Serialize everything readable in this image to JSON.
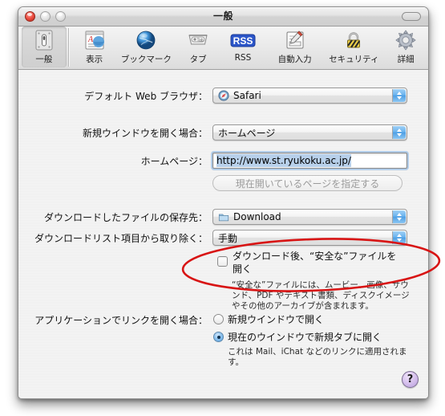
{
  "window": {
    "title": "一般",
    "controls": {
      "close": "close-button",
      "minimize": "minimize-button",
      "zoom": "zoom-button",
      "toolbar_toggle": "toolbar-toggle-button"
    }
  },
  "toolbar": {
    "items": [
      {
        "id": "general",
        "label": "一般",
        "icon": "general-icon",
        "selected": true
      },
      {
        "id": "appearance",
        "label": "表示",
        "icon": "appearance-icon",
        "selected": false
      },
      {
        "id": "bookmarks",
        "label": "ブックマーク",
        "icon": "bookmarks-icon",
        "selected": false
      },
      {
        "id": "tabs",
        "label": "タブ",
        "icon": "tabs-icon",
        "selected": false
      },
      {
        "id": "rss",
        "label": "RSS",
        "icon": "rss-icon",
        "selected": false
      },
      {
        "id": "autofill",
        "label": "自動入力",
        "icon": "autofill-icon",
        "selected": false
      },
      {
        "id": "security",
        "label": "セキュリティ",
        "icon": "security-icon",
        "selected": false
      },
      {
        "id": "advanced",
        "label": "詳細",
        "icon": "advanced-icon",
        "selected": false
      }
    ]
  },
  "form": {
    "default_browser": {
      "label": "デフォルト Web ブラウザ：",
      "value": "Safari",
      "icon": "safari-icon"
    },
    "new_window_opens": {
      "label": "新規ウインドウを開く場合：",
      "value": "ホームページ"
    },
    "homepage": {
      "label": "ホームページ：",
      "value": "http://www.st.ryukoku.ac.jp/",
      "selected": true
    },
    "set_current_page_button": {
      "label": "現在開いているページを指定する",
      "enabled": false
    },
    "download_location": {
      "label": "ダウンロードしたファイルの保存先：",
      "value": "Download",
      "icon": "folder-icon"
    },
    "remove_download_items": {
      "label": "ダウンロードリスト項目から取り除く：",
      "value": "手動"
    },
    "open_safe_files": {
      "label": "ダウンロード後、“安全な”ファイルを開く",
      "checked": false,
      "hint": "“安全な”ファイルには、ムービー、画像、サウンド、PDF やテキスト書類、ディスクイメージやその他のアーカイブが含まれます。"
    },
    "open_links_from_apps": {
      "label": "アプリケーションでリンクを開く場合：",
      "options": [
        {
          "label": "新規ウインドウで開く",
          "selected": false
        },
        {
          "label": "現在のウインドウで新規タブに開く",
          "selected": true
        }
      ],
      "hint": "これは Mail、iChat などのリンクに適用されます。"
    }
  },
  "help_button": {
    "label": "?"
  },
  "annotation": {
    "shape": "ellipse",
    "color": "#d81414"
  }
}
